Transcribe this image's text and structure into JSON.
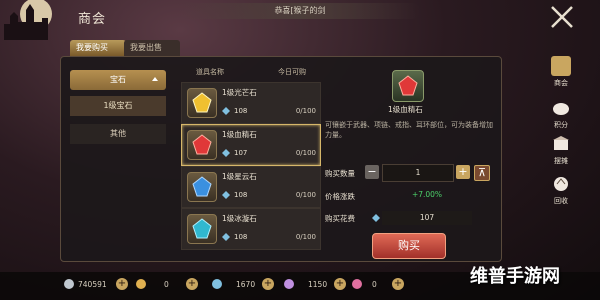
{
  "header": {
    "title": "商会",
    "announcement": "恭喜[猴子的剑"
  },
  "tabs": [
    {
      "label": "我要购买"
    },
    {
      "label": "我要出售"
    }
  ],
  "categories": {
    "head": "宝石",
    "selected": "1级宝石",
    "other": "其他"
  },
  "list": {
    "col_name": "道具名称",
    "col_limit": "今日可购"
  },
  "items": [
    {
      "name": "1级光芒石",
      "price": "108",
      "limit": "0/100",
      "gem": "yellow"
    },
    {
      "name": "1级血精石",
      "price": "107",
      "limit": "0/100",
      "gem": "red"
    },
    {
      "name": "1级星云石",
      "price": "108",
      "limit": "0/100",
      "gem": "blue"
    },
    {
      "name": "1级冰漩石",
      "price": "108",
      "limit": "0/100",
      "gem": "cyan"
    }
  ],
  "detail": {
    "name": "1级血精石",
    "description": "可镶嵌于武器、项链、戒指、耳环部位，可为装备增加力量。",
    "qty_label": "购买数量",
    "qty_value": "1",
    "change_label": "价格涨跌",
    "change_value": "+7.00%",
    "cost_label": "购买花费",
    "cost_value": "107",
    "buy_label": "购买"
  },
  "sidebar": [
    {
      "label": "商会",
      "icon": "shop-icon"
    },
    {
      "label": "积分",
      "icon": "pig-icon"
    },
    {
      "label": "摆摊",
      "icon": "stall-icon"
    },
    {
      "label": "回收",
      "icon": "recycle-icon"
    }
  ],
  "currency": [
    {
      "value": "740591",
      "color": "#c0c8d0"
    },
    {
      "value": "0",
      "color": "#e0b050"
    },
    {
      "value": "1670",
      "color": "#80c0e0"
    },
    {
      "value": "1150",
      "color": "#c090e0"
    },
    {
      "value": "0",
      "color": "#e070a0"
    }
  ],
  "watermark": "维普手游网",
  "colors": {
    "gold": "#c9a660",
    "buy_button": "#c0443a",
    "price_up": "#4cd06a"
  }
}
